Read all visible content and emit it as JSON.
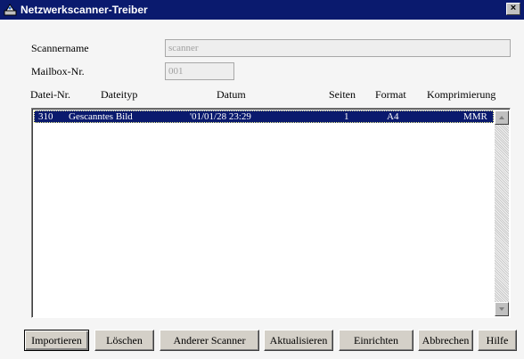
{
  "window": {
    "title": "Netzwerkscanner-Treiber",
    "close_label": "×"
  },
  "form": {
    "scanner_name_label": "Scannername",
    "scanner_name_value": "scanner",
    "mailbox_label": "Mailbox-Nr.",
    "mailbox_value": "001"
  },
  "list": {
    "columns": [
      "Datei-Nr.",
      "Dateityp",
      "Datum",
      "Seiten",
      "Format",
      "Komprimierung"
    ],
    "rows": [
      {
        "file_no": "310",
        "type": "Gescanntes Bild",
        "date": "'01/01/28 23:29",
        "pages": "1",
        "format": "A4",
        "compression": "MMR"
      }
    ],
    "selected_row": 0
  },
  "buttons": {
    "import": "Importieren",
    "delete": "Löschen",
    "other_scanner": "Anderer Scanner",
    "refresh": "Aktualisieren",
    "setup": "Einrichten",
    "cancel": "Abbrechen",
    "help": "Hilfe"
  },
  "colors": {
    "titlebar": "#0a1a6e",
    "selection": "#0a1a6e",
    "background": "#f5f5f5"
  },
  "icons": [
    "app-icon",
    "close-icon",
    "scroll-up-icon",
    "scroll-down-icon"
  ]
}
